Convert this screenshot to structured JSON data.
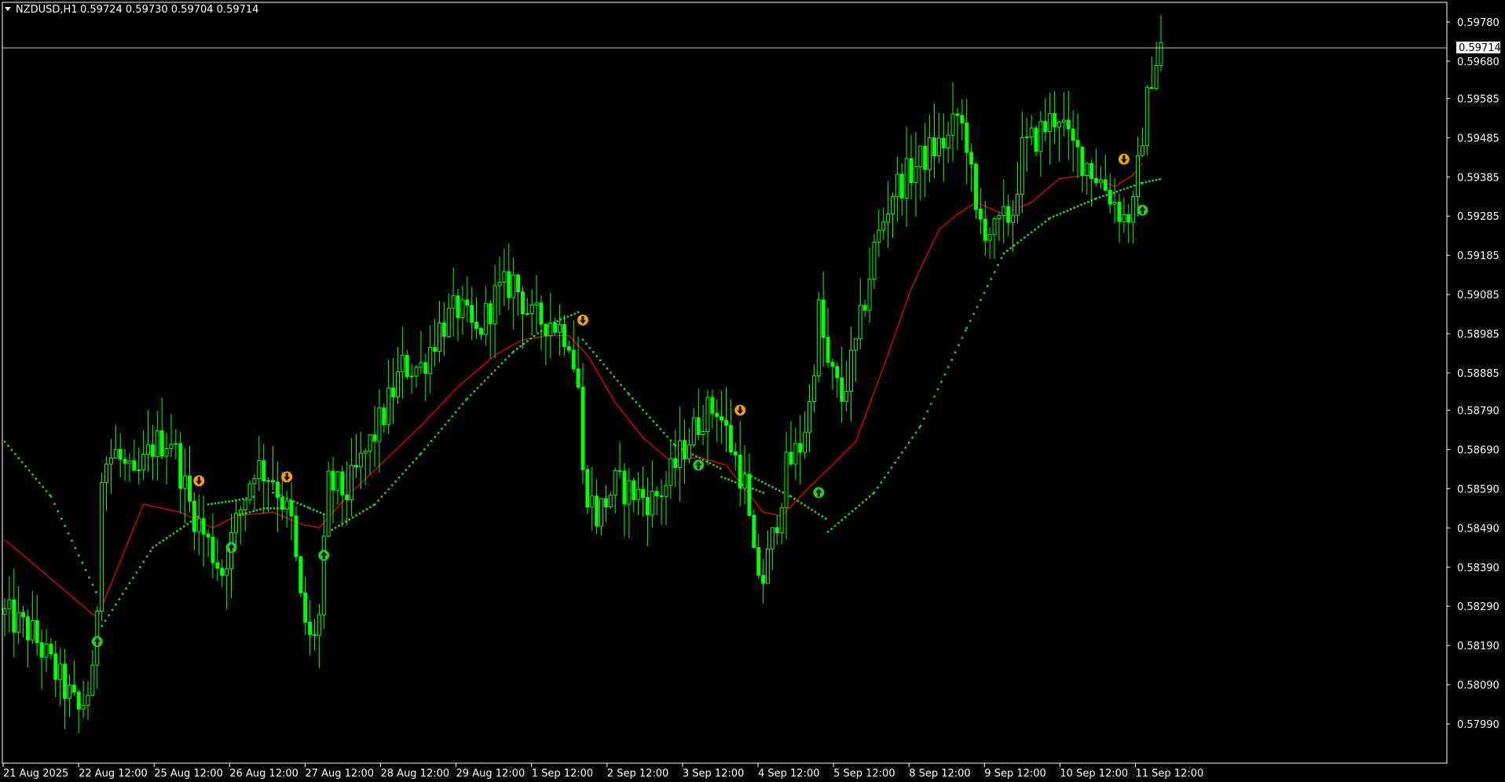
{
  "header": {
    "symbol": "NZDUSD,H1",
    "ohlc": "0.59724 0.59730 0.59704 0.59714"
  },
  "colors": {
    "background": "#000000",
    "candle": "#00ff00",
    "ma_red": "#ff0000",
    "dots_green": "#22cc22",
    "up_arrow": "#1fd11f",
    "down_arrow": "#f5a300",
    "price_line": "#b8c4cc",
    "axis": "#ffffff"
  },
  "chart_data": {
    "type": "candlestick",
    "symbol": "NZDUSD",
    "timeframe": "H1",
    "ylim": [
      0.5789,
      0.5983
    ],
    "y_ticks": [
      "0.59780",
      "0.59680",
      "0.59585",
      "0.59485",
      "0.59385",
      "0.59285",
      "0.59185",
      "0.59085",
      "0.58985",
      "0.58885",
      "0.58790",
      "0.58690",
      "0.58590",
      "0.58490",
      "0.58390",
      "0.58290",
      "0.58190",
      "0.58090",
      "0.57990"
    ],
    "x_ticks": [
      "21 Aug 2025",
      "22 Aug 12:00",
      "25 Aug 12:00",
      "26 Aug 12:00",
      "27 Aug 12:00",
      "28 Aug 12:00",
      "29 Aug 12:00",
      "1 Sep 12:00",
      "2 Sep 12:00",
      "3 Sep 12:00",
      "4 Sep 12:00",
      "5 Sep 12:00",
      "8 Sep 12:00",
      "9 Sep 12:00",
      "10 Sep 12:00",
      "11 Sep 12:00"
    ],
    "current_price": "0.59714",
    "price_path_anchors": [
      [
        0,
        0.5827
      ],
      [
        6,
        0.5822
      ],
      [
        12,
        0.581
      ],
      [
        16,
        0.5802
      ],
      [
        19,
        0.581
      ],
      [
        20,
        0.583
      ],
      [
        21,
        0.5865
      ],
      [
        24,
        0.5868
      ],
      [
        28,
        0.586
      ],
      [
        32,
        0.587
      ],
      [
        36,
        0.5872
      ],
      [
        40,
        0.5855
      ],
      [
        44,
        0.5845
      ],
      [
        47,
        0.5838
      ],
      [
        50,
        0.585
      ],
      [
        54,
        0.5865
      ],
      [
        58,
        0.5862
      ],
      [
        62,
        0.585
      ],
      [
        64,
        0.583
      ],
      [
        66,
        0.582
      ],
      [
        68,
        0.5826
      ],
      [
        70,
        0.586
      ],
      [
        74,
        0.5858
      ],
      [
        78,
        0.5868
      ],
      [
        82,
        0.5878
      ],
      [
        86,
        0.589
      ],
      [
        90,
        0.589
      ],
      [
        94,
        0.59
      ],
      [
        98,
        0.5905
      ],
      [
        102,
        0.5898
      ],
      [
        106,
        0.5908
      ],
      [
        110,
        0.5912
      ],
      [
        114,
        0.5902
      ],
      [
        118,
        0.5902
      ],
      [
        122,
        0.5898
      ],
      [
        124,
        0.5885
      ],
      [
        125,
        0.5862
      ],
      [
        128,
        0.5852
      ],
      [
        132,
        0.586
      ],
      [
        136,
        0.5858
      ],
      [
        140,
        0.5856
      ],
      [
        143,
        0.586
      ],
      [
        147,
        0.587
      ],
      [
        151,
        0.5878
      ],
      [
        154,
        0.588
      ],
      [
        157,
        0.587
      ],
      [
        160,
        0.586
      ],
      [
        162,
        0.584
      ],
      [
        164,
        0.5836
      ],
      [
        166,
        0.5846
      ],
      [
        169,
        0.5864
      ],
      [
        172,
        0.587
      ],
      [
        174,
        0.588
      ],
      [
        176,
        0.5904
      ],
      [
        178,
        0.589
      ],
      [
        181,
        0.5882
      ],
      [
        184,
        0.5895
      ],
      [
        188,
        0.592
      ],
      [
        192,
        0.5935
      ],
      [
        196,
        0.594
      ],
      [
        200,
        0.5945
      ],
      [
        204,
        0.5948
      ],
      [
        206,
        0.5954
      ],
      [
        208,
        0.5948
      ],
      [
        210,
        0.5928
      ],
      [
        214,
        0.5924
      ],
      [
        218,
        0.593
      ],
      [
        220,
        0.5945
      ],
      [
        224,
        0.595
      ],
      [
        228,
        0.5955
      ],
      [
        230,
        0.5947
      ],
      [
        234,
        0.5942
      ],
      [
        238,
        0.5936
      ],
      [
        242,
        0.5928
      ],
      [
        244,
        0.593
      ],
      [
        246,
        0.595
      ],
      [
        248,
        0.5965
      ],
      [
        250,
        0.5972
      ]
    ],
    "total_bars": 250,
    "series": [
      {
        "name": "",
        "type": "moving_average",
        "color": "#ff0000",
        "points": [
          [
            0,
            0.5846
          ],
          [
            20,
            0.5826
          ],
          [
            30,
            0.5855
          ],
          [
            38,
            0.5853
          ],
          [
            45,
            0.5849
          ],
          [
            50,
            0.5852
          ],
          [
            58,
            0.5853
          ],
          [
            64,
            0.585
          ],
          [
            68,
            0.5849
          ],
          [
            74,
            0.5857
          ],
          [
            82,
            0.5866
          ],
          [
            90,
            0.5875
          ],
          [
            98,
            0.5885
          ],
          [
            106,
            0.5893
          ],
          [
            112,
            0.5897
          ],
          [
            118,
            0.5898
          ],
          [
            122,
            0.5898
          ],
          [
            126,
            0.5893
          ],
          [
            132,
            0.5881
          ],
          [
            138,
            0.5872
          ],
          [
            144,
            0.5866
          ],
          [
            150,
            0.5867
          ],
          [
            156,
            0.5865
          ],
          [
            160,
            0.5859
          ],
          [
            164,
            0.5853
          ],
          [
            168,
            0.5852
          ],
          [
            172,
            0.5857
          ],
          [
            178,
            0.5864
          ],
          [
            184,
            0.5871
          ],
          [
            190,
            0.589
          ],
          [
            196,
            0.591
          ],
          [
            202,
            0.5925
          ],
          [
            206,
            0.5929
          ],
          [
            210,
            0.5932
          ],
          [
            216,
            0.5929
          ],
          [
            222,
            0.5932
          ],
          [
            228,
            0.5938
          ],
          [
            234,
            0.5939
          ],
          [
            240,
            0.5936
          ],
          [
            244,
            0.5939
          ],
          [
            246,
            0.5942
          ]
        ]
      },
      {
        "name": "",
        "type": "trailing_dots",
        "color": "#22cc22",
        "segments": [
          [
            [
              0,
              0.5871
            ],
            [
              10,
              0.5857
            ],
            [
              20,
              0.5832
            ]
          ],
          [
            [
              21,
              0.5824
            ],
            [
              32,
              0.5844
            ],
            [
              42,
              0.5852
            ]
          ],
          [
            [
              44,
              0.5855
            ],
            [
              50,
              0.5856
            ],
            [
              54,
              0.5857
            ]
          ],
          [
            [
              50,
              0.5852
            ],
            [
              56,
              0.5854
            ],
            [
              62,
              0.5854
            ]
          ],
          [
            [
              58,
              0.5858
            ],
            [
              66,
              0.5854
            ],
            [
              70,
              0.5852
            ]
          ],
          [
            [
              70,
              0.5848
            ],
            [
              80,
              0.5855
            ],
            [
              90,
              0.5868
            ],
            [
              100,
              0.5882
            ],
            [
              110,
              0.5894
            ],
            [
              118,
              0.5901
            ],
            [
              124,
              0.5904
            ]
          ],
          [
            [
              125,
              0.5897
            ],
            [
              135,
              0.5883
            ],
            [
              145,
              0.587
            ],
            [
              155,
              0.5864
            ]
          ],
          [
            [
              155,
              0.5862
            ],
            [
              164,
              0.5858
            ]
          ],
          [
            [
              160,
              0.5863
            ],
            [
              170,
              0.5857
            ],
            [
              178,
              0.5851
            ]
          ],
          [
            [
              178,
              0.5848
            ],
            [
              188,
              0.5858
            ],
            [
              198,
              0.5875
            ],
            [
              208,
              0.59
            ],
            [
              216,
              0.5919
            ],
            [
              226,
              0.5928
            ],
            [
              236,
              0.5933
            ],
            [
              246,
              0.5937
            ],
            [
              250,
              0.5938
            ]
          ]
        ]
      }
    ],
    "signals": [
      {
        "type": "up",
        "bar": 20,
        "price": 0.582
      },
      {
        "type": "down",
        "bar": 42,
        "price": 0.5861
      },
      {
        "type": "up",
        "bar": 49,
        "price": 0.5844
      },
      {
        "type": "down",
        "bar": 61,
        "price": 0.5862
      },
      {
        "type": "up",
        "bar": 69,
        "price": 0.5842
      },
      {
        "type": "down",
        "bar": 125,
        "price": 0.5902
      },
      {
        "type": "up",
        "bar": 150,
        "price": 0.5865
      },
      {
        "type": "down",
        "bar": 159,
        "price": 0.5879
      },
      {
        "type": "up",
        "bar": 176,
        "price": 0.5858
      },
      {
        "type": "down",
        "bar": 242,
        "price": 0.5943
      },
      {
        "type": "up",
        "bar": 246,
        "price": 0.593
      }
    ]
  }
}
